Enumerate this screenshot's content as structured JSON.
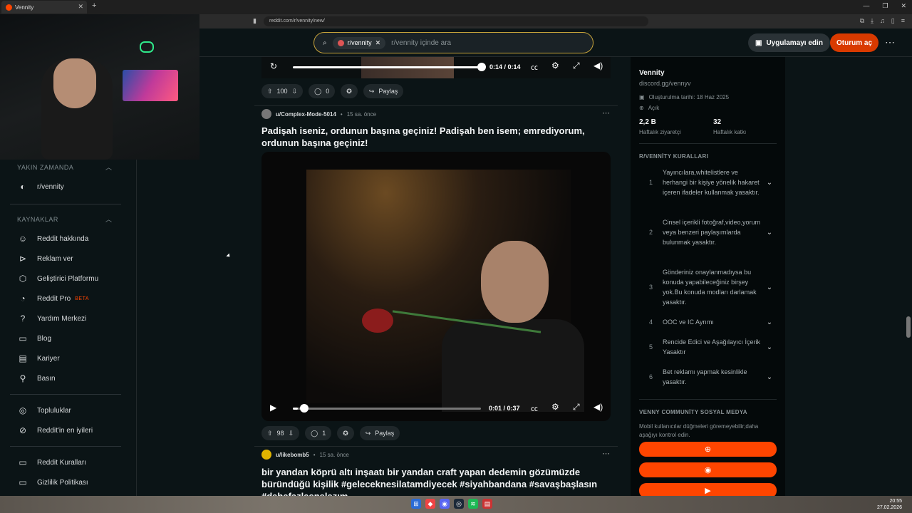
{
  "browser": {
    "tab_title": "Vennity",
    "url": "reddit.com/r/vennity/new/"
  },
  "header": {
    "search_chip": "r/vennity",
    "search_placeholder": "r/vennity içinde ara",
    "app_button": "Uygulamayı edin",
    "login_button": "Oturum aç"
  },
  "sidebar": {
    "recent_title": "YAKIN ZAMANDA",
    "recent_items": [
      {
        "label": "r/vennity",
        "icon": "community-avatar-icon"
      }
    ],
    "resources_title": "KAYNAKLAR",
    "resource_items": [
      {
        "label": "Reddit hakkında",
        "icon": "reddit-icon"
      },
      {
        "label": "Reklam ver",
        "icon": "megaphone-icon"
      },
      {
        "label": "Geliştirici Platformu",
        "icon": "developer-platform-icon"
      },
      {
        "label": "Reddit Pro",
        "icon": "reddit-pro-icon",
        "badge": "BETA"
      },
      {
        "label": "Yardım Merkezi",
        "icon": "help-icon"
      },
      {
        "label": "Blog",
        "icon": "book-icon"
      },
      {
        "label": "Kariyer",
        "icon": "briefcase-icon"
      },
      {
        "label": "Basın",
        "icon": "microphone-icon"
      }
    ],
    "community_items": [
      {
        "label": "Topluluklar",
        "icon": "communities-icon"
      },
      {
        "label": "Reddit'in en iyileri",
        "icon": "best-of-icon"
      }
    ],
    "policy_items": [
      {
        "label": "Reddit Kuralları",
        "icon": "rules-book-icon"
      },
      {
        "label": "Gizlilik Politikası",
        "icon": "privacy-book-icon"
      }
    ]
  },
  "feed": {
    "top_video": {
      "time": "0:14 / 0:14",
      "progress": 1.0
    },
    "top_actions": {
      "votes": "100",
      "comments": "0",
      "share": "Paylaş"
    },
    "posts": [
      {
        "user": "u/Complex-Mode-5014",
        "time": "15 sa. önce",
        "title": "Padişah iseniz, ordunun başına geçiniz! Padişah ben isem; emrediyorum, ordunun başına geçiniz!",
        "video_time": "0:01 / 0:37",
        "video_progress": 0.027,
        "votes": "98",
        "comments": "1",
        "share": "Paylaş"
      },
      {
        "user": "u/likebomb5",
        "time": "15 sa. önce",
        "title": "bir yandan köprü altı inşaatı bir yandan craft yapan dedemin gözümüzde büründüğü kişilik #geleceknesilatamdiyecek #siyahbandana #savaşbaşlasın #dahafazlasnslazım"
      }
    ]
  },
  "community": {
    "name": "Vennity",
    "subtitle": "discord.gg/vennyv",
    "created": "Oluşturulma tarihi: 18 Haz 2025",
    "visibility": "Açık",
    "stat1_value": "2,2 B",
    "stat1_label": "Haftalık ziyaretçi",
    "stat2_value": "32",
    "stat2_label": "Haftalık katkı",
    "rules_title": "R/VENNİTY KURALLARI",
    "rules": [
      {
        "num": "1",
        "text": "Yayıncılara,whitelistlere ve herhangi bir kişiye yönelik hakaret içeren ifadeler kullanmak yasaktır."
      },
      {
        "num": "2",
        "text": "Cinsel içerikli fotoğraf,video,yorum veya benzeri paylaşımlarda bulunmak yasaktır."
      },
      {
        "num": "3",
        "text": "Gönderiniz onaylanmadıysa bu konuda yapabileceğiniz birşey yok.Bu konuda modları darlamak yasaktır."
      },
      {
        "num": "4",
        "text": "OOC ve IC Ayrımı"
      },
      {
        "num": "5",
        "text": "Rencide Edici ve Aşağılayıcı İçerik Yasaktır"
      },
      {
        "num": "6",
        "text": "Bet reklamı yapmak kesinlikle yasaktır."
      }
    ],
    "social_title": "VENNY COMMUNİTY SOSYAL MEDYA",
    "social_desc": "Mobil kullanıcılar düğmeleri göremeyebilir;daha aşağıyı kontrol edin.",
    "social_buttons": [
      "globe-icon",
      "discord-icon",
      "youtube-icon"
    ],
    "accent": "#ff4500"
  },
  "taskbar": {
    "time": "20:55",
    "date": "27.02.2026"
  }
}
